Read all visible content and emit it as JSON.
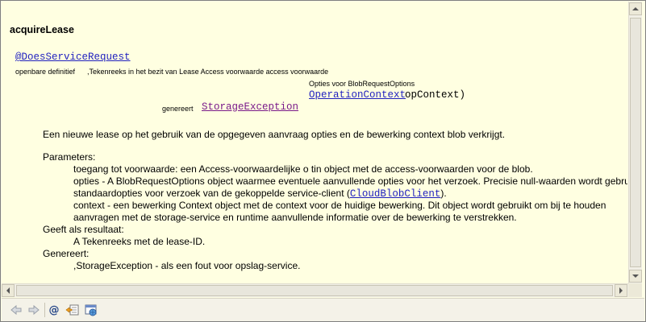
{
  "doc": {
    "method_title": "acquireLease",
    "annotation": "@DoesServiceRequest",
    "signature": {
      "modifier": "openbare definitief",
      "param1": ",Tekenreeks in het bezit van Lease Access voorwaarde access voorwaarde",
      "param2_type": "Opties voor BlobRequestOptions",
      "param3_type": "OperationContext",
      "param3_name": "opContext)",
      "throws_label": "genereert",
      "throws_type": "StorageException"
    },
    "description": "Een nieuwe lease op het gebruik van de opgegeven aanvraag opties en de bewerking context blob verkrijgt.",
    "parameters_label": "Parameters:",
    "params": [
      "toegang tot voorwaarde: een Access-voorwaardelijke o tin object met de access-voorwaarden voor de blob.",
      "opties - A BlobRequestOptions object waarmee eventuele aanvullende opties voor het verzoek. Precisie null-waarden wordt gebruikt de",
      "standaardopties voor verzoek van de gekoppelde service-client (",
      "CloudBlobClient",
      ").",
      "context - een bewerking Context object met de context voor de huidige bewerking. Dit object wordt gebruikt om bij te houden",
      "aanvragen met de storage-service en runtime aanvullende informatie over de bewerking te verstrekken."
    ],
    "returns_label": "Geeft als resultaat:",
    "returns_text": "A Tekenreeks met de lease-ID.",
    "throws_section_label": "Genereert:",
    "throws_section_text": ",StorageException - als een fout voor opslag-service."
  },
  "toolbar": {
    "icons": [
      "back-arrow-icon",
      "forward-arrow-icon",
      "at-sign-icon",
      "open-declaration-icon",
      "open-external-icon"
    ],
    "at_glyph": "@"
  },
  "colors": {
    "background": "#ffffe1",
    "link": "#1f1fbf",
    "visited_link": "#7a1a8a"
  }
}
